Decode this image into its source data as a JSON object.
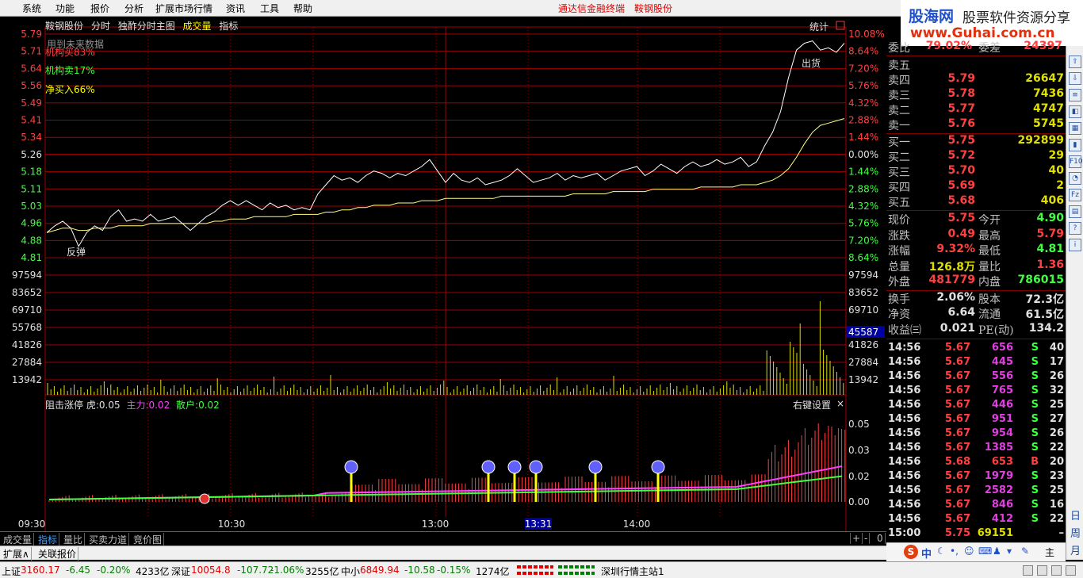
{
  "menu": [
    "系统",
    "功能",
    "报价",
    "分析",
    "扩展市场行情",
    "资讯",
    "工具",
    "帮助"
  ],
  "center_links": [
    "通达信金融终端",
    "鞍钢股份"
  ],
  "logo": {
    "line1a": "股海网",
    "line1b": "股票软件资源分享",
    "line2": "www.Guhai.com.cn"
  },
  "chart_header": {
    "stock": "鞍钢股份",
    "items": [
      "分时",
      "独酢分时主图",
      "成交量",
      "指标"
    ],
    "stats": "统计"
  },
  "annotations": {
    "future": "用到未来数据",
    "inst_buy": "机构买83%",
    "inst_sell": "机构卖17%",
    "net_buy": "净买入66%",
    "rebound": "反弹",
    "sell_signal": "出货"
  },
  "indicator_header": {
    "name": "阻击涨停",
    "tiger_label": "虎:",
    "tiger": "0.05",
    "main_label": "主力:",
    "main": "0.02",
    "retail_label": "散户:",
    "retail": "0.02",
    "right_settings": "右键设置",
    "close": "×"
  },
  "price_axis_left": [
    "5.79",
    "5.71",
    "5.64",
    "5.56",
    "5.49",
    "5.41",
    "5.34",
    "5.26",
    "5.18",
    "5.11",
    "5.03",
    "4.96",
    "4.88",
    "4.81"
  ],
  "price_axis_right": [
    "10.08%",
    "8.64%",
    "7.20%",
    "5.76%",
    "4.32%",
    "2.88%",
    "1.44%",
    "0.00%",
    "1.44%",
    "2.88%",
    "4.32%",
    "5.76%",
    "7.20%",
    "8.64%"
  ],
  "vol_axis_left": [
    "97594",
    "83652",
    "69710",
    "55768",
    "41826",
    "27884",
    "13942"
  ],
  "vol_axis_right": [
    "97594",
    "83652",
    "69710",
    "55768",
    "41826",
    "27884",
    "13942"
  ],
  "vol_cursor": "45587",
  "ind_axis_right": [
    "0.05",
    "0.03",
    "0.02",
    "0.00"
  ],
  "time_axis": [
    "09:30",
    "10:30",
    "13:00",
    "13:31",
    "14:00"
  ],
  "chart_data": {
    "type": "line",
    "price_range": [
      4.81,
      5.79
    ],
    "series": [
      {
        "values": [
          4.92,
          4.95,
          4.97,
          4.94,
          4.86,
          4.92,
          4.95,
          4.93,
          4.99,
          5.02,
          4.97,
          4.98,
          4.97,
          5.0,
          4.97,
          4.98,
          4.99,
          4.96,
          4.93,
          4.96,
          4.99,
          5.01,
          5.04,
          5.06,
          5.04,
          5.06,
          5.04,
          5.02,
          5.05,
          5.03,
          5.04,
          5.02,
          5.03,
          5.02,
          5.09,
          5.13,
          5.17,
          5.15,
          5.16,
          5.14,
          5.17,
          5.19,
          5.18,
          5.16,
          5.18,
          5.17,
          5.19,
          5.21,
          5.24,
          5.19,
          5.14,
          5.18,
          5.15,
          5.14,
          5.16,
          5.13,
          5.14,
          5.15,
          5.17,
          5.2,
          5.17,
          5.14,
          5.15,
          5.16,
          5.18,
          5.15,
          5.17,
          5.16,
          5.17,
          5.18,
          5.15,
          5.17,
          5.19,
          5.2,
          5.21,
          5.17,
          5.19,
          5.22,
          5.2,
          5.18,
          5.21,
          5.23,
          5.21,
          5.22,
          5.24,
          5.22,
          5.23,
          5.25,
          5.21,
          5.23,
          5.3,
          5.36,
          5.45,
          5.6,
          5.72,
          5.75,
          5.76,
          5.72,
          5.73,
          5.71,
          5.75
        ]
      },
      {
        "values": [
          4.92,
          4.93,
          4.94,
          4.94,
          4.93,
          4.93,
          4.94,
          4.94,
          4.94,
          4.95,
          4.95,
          4.95,
          4.95,
          4.96,
          4.96,
          4.96,
          4.96,
          4.96,
          4.96,
          4.96,
          4.96,
          4.97,
          4.97,
          4.98,
          4.98,
          4.98,
          4.99,
          4.99,
          4.99,
          4.99,
          4.99,
          5.0,
          5.0,
          5.0,
          5.0,
          5.01,
          5.01,
          5.02,
          5.02,
          5.03,
          5.03,
          5.04,
          5.04,
          5.04,
          5.05,
          5.05,
          5.05,
          5.06,
          5.06,
          5.06,
          5.07,
          5.07,
          5.07,
          5.07,
          5.07,
          5.07,
          5.07,
          5.08,
          5.08,
          5.08,
          5.08,
          5.08,
          5.08,
          5.08,
          5.08,
          5.08,
          5.09,
          5.09,
          5.09,
          5.09,
          5.09,
          5.1,
          5.1,
          5.1,
          5.1,
          5.1,
          5.11,
          5.11,
          5.11,
          5.11,
          5.11,
          5.11,
          5.12,
          5.12,
          5.12,
          5.12,
          5.12,
          5.13,
          5.13,
          5.13,
          5.14,
          5.15,
          5.17,
          5.2,
          5.25,
          5.31,
          5.36,
          5.39,
          5.4,
          5.41,
          5.42
        ]
      }
    ]
  },
  "order_book": {
    "top": {
      "label1": "委比",
      "val1": "79.02%",
      "label2": "委差",
      "val2": "24397"
    },
    "sells": [
      {
        "label": "卖五",
        "price": "",
        "vol": ""
      },
      {
        "label": "卖四",
        "price": "5.79",
        "vol": "26647"
      },
      {
        "label": "卖三",
        "price": "5.78",
        "vol": "7436"
      },
      {
        "label": "卖二",
        "price": "5.77",
        "vol": "4747"
      },
      {
        "label": "卖一",
        "price": "5.76",
        "vol": "5745"
      }
    ],
    "buys": [
      {
        "label": "买一",
        "price": "5.75",
        "vol": "292899"
      },
      {
        "label": "买二",
        "price": "5.72",
        "vol": "29"
      },
      {
        "label": "买三",
        "price": "5.70",
        "vol": "40"
      },
      {
        "label": "买四",
        "price": "5.69",
        "vol": "2"
      },
      {
        "label": "买五",
        "price": "5.68",
        "vol": "406"
      }
    ]
  },
  "quote": [
    {
      "l1": "现价",
      "v1": "5.75",
      "c1": "#ff4040",
      "l2": "今开",
      "v2": "4.90",
      "c2": "#40ff40"
    },
    {
      "l1": "涨跌",
      "v1": "0.49",
      "c1": "#ff4040",
      "l2": "最高",
      "v2": "5.79",
      "c2": "#ff4040"
    },
    {
      "l1": "涨幅",
      "v1": "9.32%",
      "c1": "#ff4040",
      "l2": "最低",
      "v2": "4.81",
      "c2": "#40ff40"
    },
    {
      "l1": "总量",
      "v1": "126.8万",
      "c1": "#e0e000",
      "l2": "量比",
      "v2": "1.36",
      "c2": "#ff4040"
    },
    {
      "l1": "外盘",
      "v1": "481779",
      "c1": "#ff4040",
      "l2": "内盘",
      "v2": "786015",
      "c2": "#40ff40"
    },
    {
      "l1": "换手",
      "v1": "2.06%",
      "c1": "#e0e0e0",
      "l2": "股本",
      "v2": "72.3亿",
      "c2": "#e0e0e0"
    },
    {
      "l1": "净资",
      "v1": "6.64",
      "c1": "#e0e0e0",
      "l2": "流通",
      "v2": "61.5亿",
      "c2": "#e0e0e0"
    },
    {
      "l1": "收益㈢",
      "v1": "0.021",
      "c1": "#e0e0e0",
      "l2": "PE(动)",
      "v2": "134.2",
      "c2": "#e0e0e0"
    }
  ],
  "ticks": [
    {
      "t": "14:56",
      "p": "5.67",
      "v": "656",
      "s": "S",
      "n": "40"
    },
    {
      "t": "14:56",
      "p": "5.67",
      "v": "445",
      "s": "S",
      "n": "17"
    },
    {
      "t": "14:56",
      "p": "5.67",
      "v": "556",
      "s": "S",
      "n": "26"
    },
    {
      "t": "14:56",
      "p": "5.67",
      "v": "765",
      "s": "S",
      "n": "32"
    },
    {
      "t": "14:56",
      "p": "5.67",
      "v": "446",
      "s": "S",
      "n": "25"
    },
    {
      "t": "14:56",
      "p": "5.67",
      "v": "951",
      "s": "S",
      "n": "27"
    },
    {
      "t": "14:56",
      "p": "5.67",
      "v": "954",
      "s": "S",
      "n": "26"
    },
    {
      "t": "14:56",
      "p": "5.67",
      "v": "1385",
      "s": "S",
      "n": "22"
    },
    {
      "t": "14:56",
      "p": "5.68",
      "v": "653",
      "s": "B",
      "n": "20"
    },
    {
      "t": "14:56",
      "p": "5.67",
      "v": "1979",
      "s": "S",
      "n": "23"
    },
    {
      "t": "14:56",
      "p": "5.67",
      "v": "2582",
      "s": "S",
      "n": "25"
    },
    {
      "t": "14:56",
      "p": "5.67",
      "v": "846",
      "s": "S",
      "n": "16"
    },
    {
      "t": "14:56",
      "p": "5.67",
      "v": "412",
      "s": "S",
      "n": "22"
    },
    {
      "t": "15:00",
      "p": "5.75",
      "v": "69151",
      "s": "",
      "n": "–"
    }
  ],
  "tabs1": [
    "成交量",
    "指标",
    "量比",
    "买卖力道",
    "竞价图"
  ],
  "tabs2": [
    "扩展∧",
    "关联报价"
  ],
  "tabs_right": [
    "+",
    "-",
    "0"
  ],
  "status": [
    {
      "text": "上证",
      "color": "#000"
    },
    {
      "text": "3160.17",
      "color": "#e00000"
    },
    {
      "text": "-6.45",
      "color": "#008000"
    },
    {
      "text": "-0.20%",
      "color": "#008000"
    },
    {
      "text": "4233亿",
      "color": "#000"
    },
    {
      "text": "深证",
      "color": "#000"
    },
    {
      "text": "10054.8",
      "color": "#e00000"
    },
    {
      "text": "-107.72",
      "color": "#008000"
    },
    {
      "text": "-1.06%",
      "color": "#008000"
    },
    {
      "text": "3255亿",
      "color": "#000"
    },
    {
      "text": "中小",
      "color": "#000"
    },
    {
      "text": "6849.94",
      "color": "#e00000"
    },
    {
      "text": "-10.58",
      "color": "#008000"
    },
    {
      "text": "-0.15%",
      "color": "#008000"
    },
    {
      "text": "1274亿",
      "color": "#000"
    },
    {
      "text": "深圳行情主站1",
      "color": "#000"
    }
  ],
  "colors": {
    "price": "#ffffff",
    "avg": "#ffff80",
    "grid": "#a00000",
    "vol": "#e0e000",
    "ind_red": "#ff4040",
    "ind_magenta": "#ff40ff",
    "ind_green": "#40ff40"
  },
  "side_toolbar_icons": [
    "up-arrow",
    "down-arrow",
    "list",
    "chart",
    "grid",
    "candle",
    "f10",
    "pie",
    "fz",
    "stats",
    "help",
    "info"
  ],
  "side_toolbar_labels": [
    "日",
    "周",
    "月"
  ]
}
